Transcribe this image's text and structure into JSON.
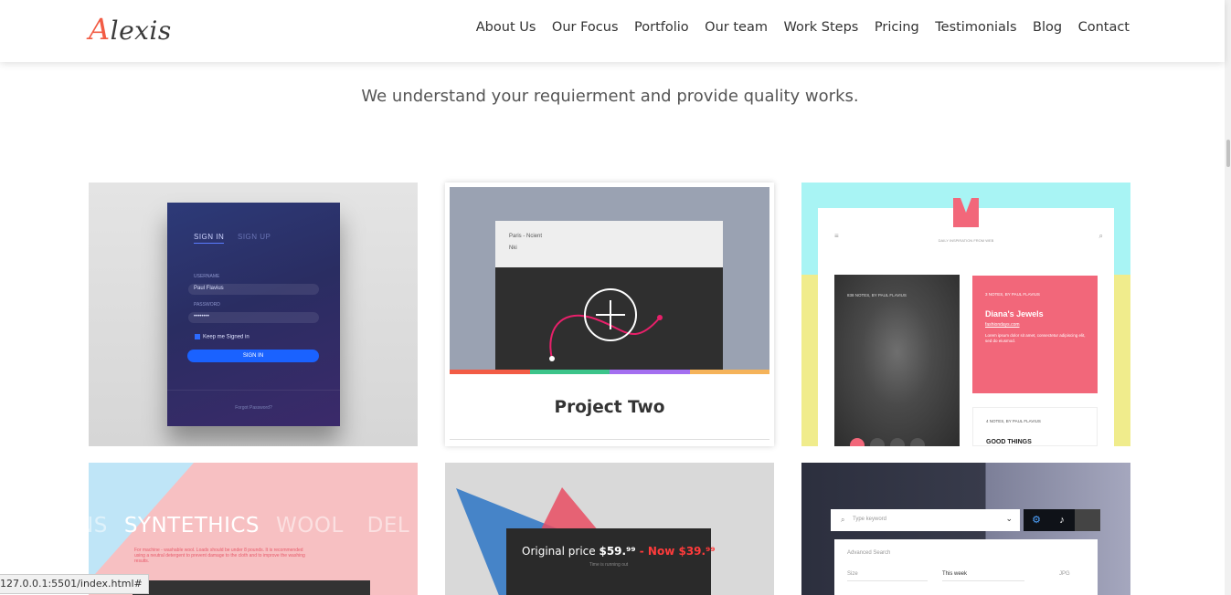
{
  "header": {
    "logo_initial": "A",
    "logo_rest": "lexis",
    "nav": [
      "About Us",
      "Our Focus",
      "Portfolio",
      "Our team",
      "Work Steps",
      "Pricing",
      "Testimonials",
      "Blog",
      "Contact"
    ]
  },
  "tagline": "We understand your requierment and provide quality works.",
  "portfolio": {
    "signin_card": {
      "tab_active": "SIGN IN",
      "tab_inactive": "SIGN UP",
      "username_label": "USERNAME",
      "username_value": "Paul Flavius",
      "password_label": "PASSWORD",
      "password_value": "••••••••",
      "keep_signed": "Keep me Signed in",
      "button": "SIGN IN",
      "forgot": "Forgot Password?"
    },
    "project_two": {
      "title": "Project Two",
      "route_from": "Paris - Ncient",
      "route_to": "Nki",
      "bar_colors": [
        "#f25c45",
        "#3cc48a",
        "#a46ff0",
        "#f5b35a"
      ]
    },
    "app_card": {
      "subtitle": "DAILY INSPIRATION FROM WEB",
      "photo_caption": "838 NOTES, BY PAUL FLAVIUS",
      "feature_meta": "3 NOTES, BY PAUL FLAVIUS",
      "feature_title": "Diana's Jewels",
      "feature_link": "fashiondays.com",
      "feature_text": "Lorem ipsum dolor sit amet, consectetur adipiscing elit, sed do eiusmod.",
      "second_meta": "4 NOTES, BY PAUL FLAVIUS",
      "second_title": "GOOD THINGS"
    },
    "fabric_card": {
      "word_left": "NS",
      "word_main": "SYNTETHICS",
      "word_next": "WOOL",
      "word_right": "DEL",
      "desc": "For machine - washable wool. Loads should be under 8 pounds. It is recommended using a neutral detergent to prevent damage to the cloth and to improve the washing results."
    },
    "price_card": {
      "label": "Original price",
      "original": "$59.⁹⁹",
      "now": " - Now $39.⁹⁹",
      "sub": "Time is running out"
    },
    "search_card": {
      "placeholder": "Type keyword",
      "adv_title": "Advanced Search",
      "size_label": "Size",
      "date_label": "This week",
      "format_label": "JPG"
    }
  },
  "status_url": "127.0.0.1:5501/index.html#"
}
